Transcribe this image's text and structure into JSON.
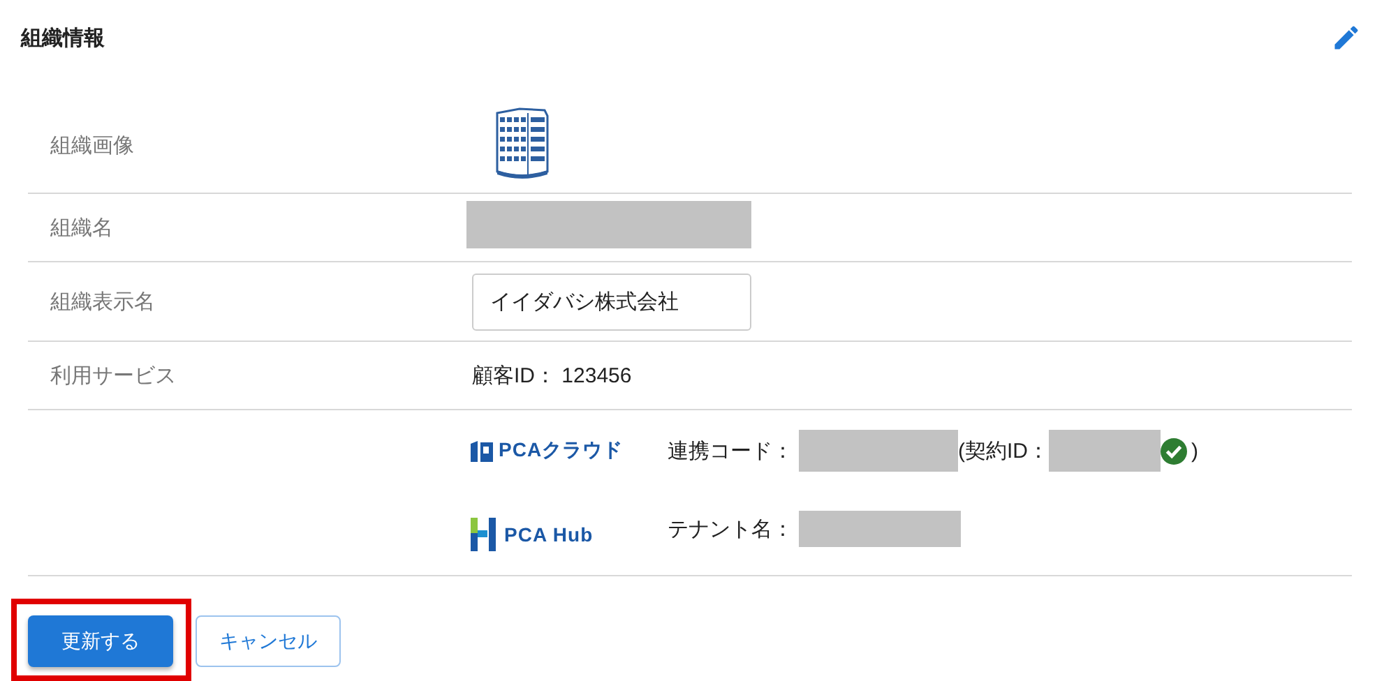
{
  "section": {
    "title": "組織情報"
  },
  "rows": [
    {
      "label": "組織画像",
      "kind": "image"
    },
    {
      "label": "組織名",
      "kind": "redacted"
    },
    {
      "label": "組織表示名",
      "kind": "input",
      "value": "イイダバシ株式会社"
    },
    {
      "label": "利用サービス",
      "kind": "text",
      "text": "顧客ID： 123456"
    }
  ],
  "services": [
    {
      "kind": "cloud",
      "logo": "PCAクラウド",
      "field_label": "連携コード：",
      "contract_open": "(契約ID：",
      "verified": true,
      "contract_close": ")"
    },
    {
      "kind": "hub",
      "logo": "PCA Hub",
      "field_label": "テナント名："
    }
  ],
  "buttons": [
    {
      "label": "更新する",
      "kind": "primary",
      "highlighted": true
    },
    {
      "label": "キャンセル",
      "kind": "secondary",
      "highlighted": false
    }
  ]
}
